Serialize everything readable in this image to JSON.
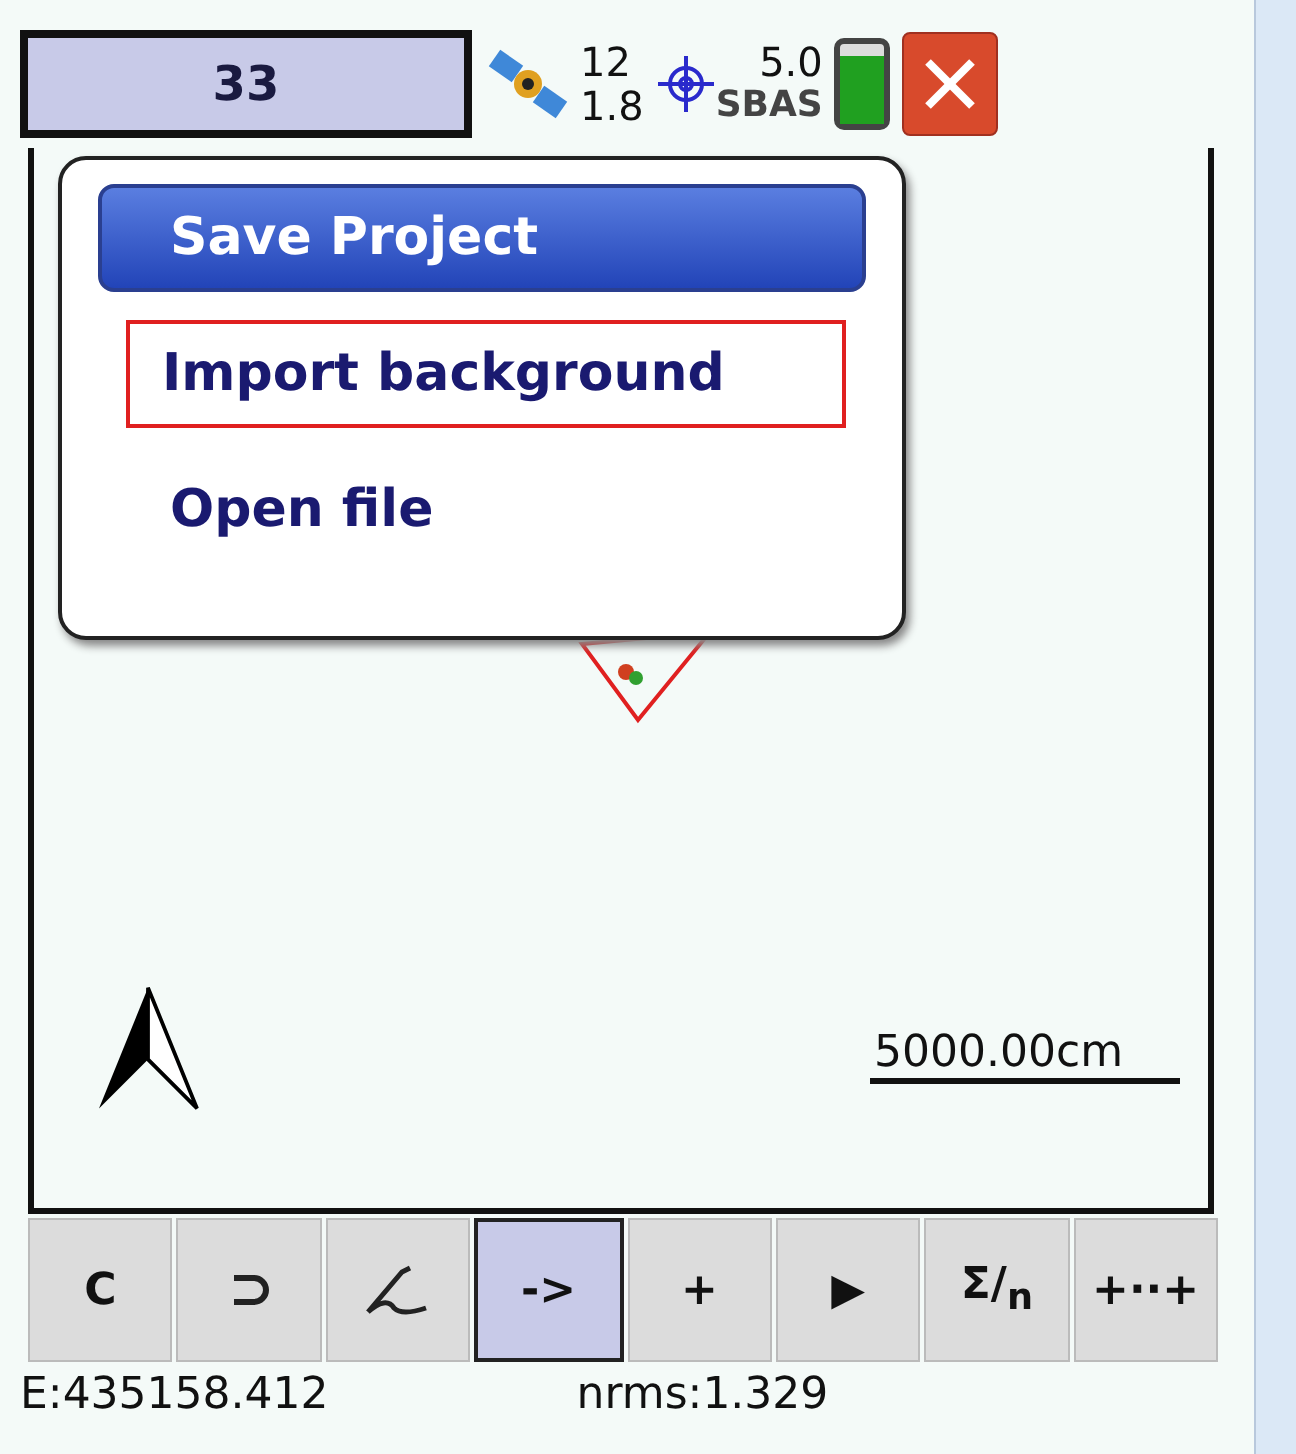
{
  "header": {
    "counter": "33",
    "satellites": "12",
    "pdop": "1.8",
    "accuracy": "5.0",
    "correction": "SBAS"
  },
  "menu": {
    "items": [
      {
        "label": "Save Project",
        "selected": true,
        "focused": false
      },
      {
        "label": "Import background",
        "selected": false,
        "focused": true
      },
      {
        "label": "Open file",
        "selected": false,
        "focused": false
      }
    ]
  },
  "map": {
    "scale": "5000.00cm"
  },
  "toolbar": [
    {
      "kind": "text",
      "label": "C",
      "selected": false
    },
    {
      "kind": "undo",
      "selected": false
    },
    {
      "kind": "pen",
      "selected": false
    },
    {
      "kind": "text",
      "label": "->",
      "selected": true
    },
    {
      "kind": "text",
      "label": "+",
      "selected": false
    },
    {
      "kind": "text",
      "label": "▶",
      "selected": false
    },
    {
      "kind": "text",
      "label": "Σ/$_{n}$",
      "selected": false
    },
    {
      "kind": "text",
      "label": "+··+",
      "selected": false
    }
  ],
  "status": {
    "easting": "E:435158.412",
    "nrms": "nrms:1.329"
  }
}
